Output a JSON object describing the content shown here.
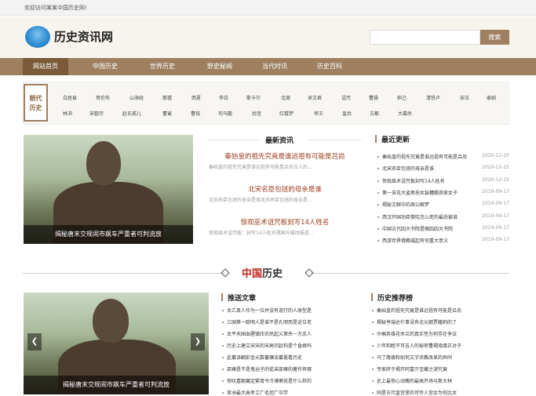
{
  "topbar": {
    "welcome": "欢迎访问某某中国历史网!"
  },
  "header": {
    "site_name": "历史资讯网",
    "search_placeholder": "",
    "search_button": "搜索"
  },
  "nav": [
    "网站首页",
    "中国历史",
    "世界历史",
    "野史秘闻",
    "当代时讯",
    "历史百科"
  ],
  "dynasty": {
    "label_line1": "朝代",
    "label_line2": "历史",
    "row1": [
      "白居易",
      "哥伦布",
      "山海经",
      "慈禧",
      "西夏",
      "李白",
      "斯卡尔",
      "北周",
      "卓文君",
      "诅咒",
      "曹操",
      "妲己",
      "清铁卢",
      "宋玉",
      "泰剧"
    ],
    "row2": [
      "林冲",
      "宋叡宗",
      "赵氏孤儿",
      "曹寅",
      "曹铭",
      "司马懿",
      "后宫",
      "红楼梦",
      "帝王",
      "皇后",
      "古都",
      "大幕杀"
    ]
  },
  "featured": {
    "caption": "揭秘唐末交规闹市飙车严重者可判流放"
  },
  "latest_news": {
    "title": "最新资讯",
    "items": [
      {
        "title": "秦始皇的祖先究竟是谁远祖有可能是吕尚",
        "desc": "秦始皇的祖先究竟是谁远祖有可能是吕尚古人的..."
      },
      {
        "title": "北宋名臣包拯的母亲是谁",
        "desc": "北宋名臣包拯的母亲是谁北宋名臣包拯的母亲是..."
      },
      {
        "title": "惊现巫术诅咒板刻写14人姓名",
        "desc": "惊现巫术诅咒板：刻写14人姓名揭国外媒体报道..."
      }
    ]
  },
  "recent_updates": {
    "title": "最近更新",
    "items": [
      {
        "title": "秦始皇的祖先究竟是谁远祖有可能是吕尚",
        "date": "2020-12-25"
      },
      {
        "title": "北宋名臣包拯的母亲是谁",
        "date": "2020-12-25"
      },
      {
        "title": "惊现巫术诅咒板刻写14人姓名",
        "date": "2020-12-25"
      },
      {
        "title": "第一采花大盗男扮女装糟蹋良家女子",
        "date": "2019-09-17"
      },
      {
        "title": "揭秘文献中的周公解梦",
        "date": "2019-09-17"
      },
      {
        "title": "西汉开国功臣樊哙怎么死的最后被谁",
        "date": "2019-09-17"
      },
      {
        "title": "中国古代四大书院是哪四四大书院",
        "date": "2019-09-17"
      },
      {
        "title": "西游世界佛教威起有何重大意义",
        "date": "2019-09-17"
      }
    ]
  },
  "china_history": {
    "title_red": "中国",
    "title_rest": "历史",
    "featured_caption": "揭秘唐末交规闹市飙车严重者可判流放",
    "prev_arrow": "❮",
    "next_arrow": "❯",
    "recommended": {
      "title": "推送文章",
      "items": [
        "太乙真人作为一位并没有道行的人原型是",
        "三国第一聪明人是谁不是孔明而是这位老",
        "太平天国血腥镇压农民起义第杀一万余人",
        "历史上建立宋宋的宋高宗赵构是个昏君吗",
        "此纂译翻彭金元数蕃攘谈纂嚣看历史",
        "邵雍是不是鬼谷子的徒弟邵雍的著作有哪",
        "惊叹嘉朝奠定繁育今冷漠喇说是什么样的",
        "亚洲最大高考工厂毛坦厂中学"
      ]
    },
    "rank": {
      "title": "历史推荐榜",
      "items": [
        "秦始皇的祖先究竟是谁远祖有可能是吕尚",
        "揭秘亨端达什事没有北元朝贾藉刺的了",
        "巾帼英雄花木兰的真实性为何存在争议",
        "少年和睦不可吉人的秘密曹褐戏缘正对子",
        "马丁路德和如何文字浓教改革的异同",
        "专家终于揭开阿富汗宝藏之谜究竟",
        "史上最惊心动魄的最高开场与斯大林",
        "同是古代皇宫里的可怜人宫女为何比太"
      ]
    }
  }
}
